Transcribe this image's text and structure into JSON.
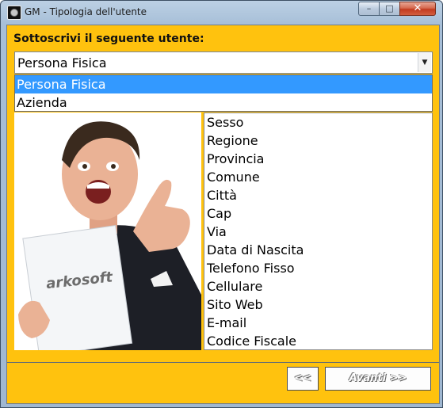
{
  "window": {
    "title": "GM - Tipologia dell'utente",
    "controls": {
      "minimize": "–",
      "maximize": "□",
      "close": "✕"
    }
  },
  "form": {
    "label": "Sottoscrivi il seguente utente:",
    "combo_value": "Persona Fisica",
    "options": [
      {
        "label": "Persona Fisica",
        "selected": true
      },
      {
        "label": "Azienda",
        "selected": false
      }
    ],
    "fields": [
      "Sesso",
      "Regione",
      "Provincia",
      "Comune",
      "Città",
      "Cap",
      "Via",
      "Data di Nascita",
      "Telefono Fisso",
      "Cellulare",
      "Sito Web",
      "E-mail",
      "Codice Fiscale"
    ]
  },
  "photo": {
    "sign_text": "arkosoft"
  },
  "buttons": {
    "back": "<<",
    "next": "Avanti >>"
  },
  "colors": {
    "panel": "#ffc20e",
    "selection": "#3399ff"
  }
}
